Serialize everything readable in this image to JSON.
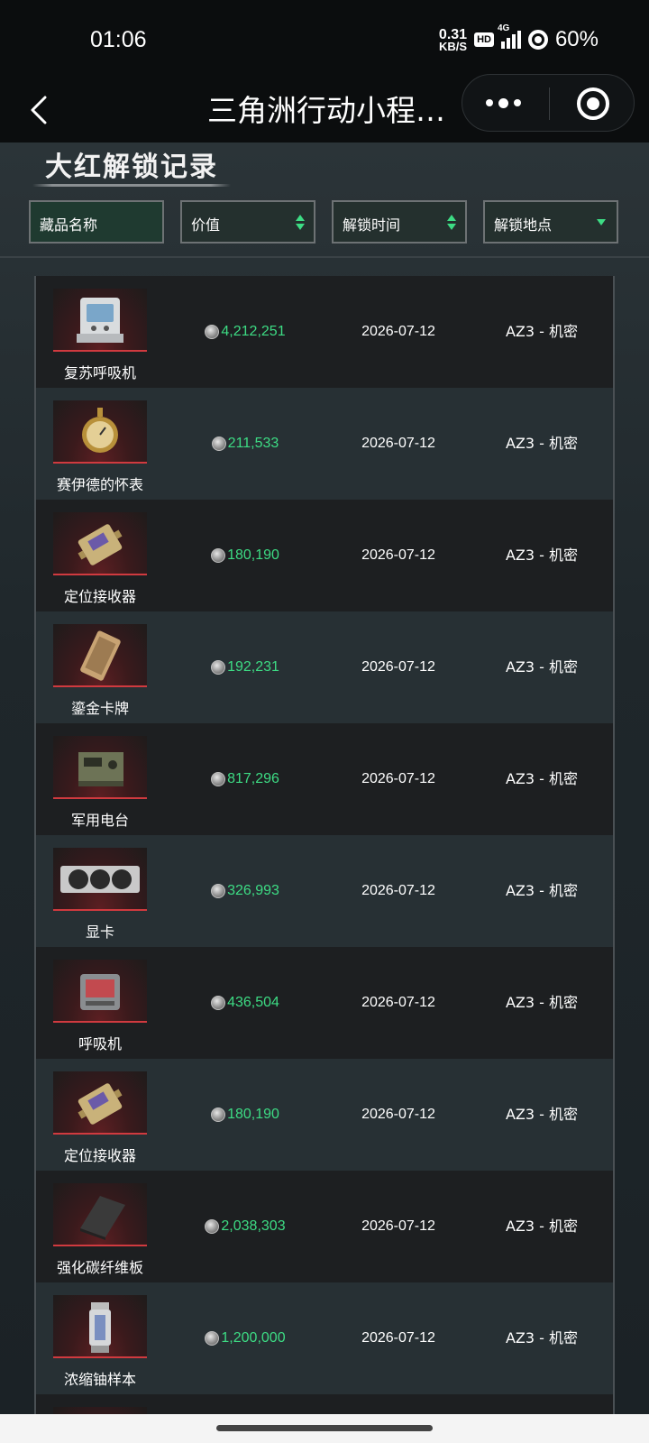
{
  "status_bar": {
    "time": "01:06",
    "net_speed_value": "0.31",
    "net_speed_unit": "KB/S",
    "hd_badge": "HD",
    "network_type": "4G",
    "battery": "60%"
  },
  "title_bar": {
    "title": "三角洲行动小程…"
  },
  "section": {
    "title": "大红解锁记录"
  },
  "filters": [
    {
      "label": "藏品名称"
    },
    {
      "label": "价值"
    },
    {
      "label": "解锁时间"
    },
    {
      "label": "解锁地点"
    }
  ],
  "items": [
    {
      "name": "复苏呼吸机",
      "value": "4,212,251",
      "date": "2026-07-12",
      "location": "AZ3 - 机密",
      "icon": "resuscitator-icon"
    },
    {
      "name": "赛伊德的怀表",
      "value": "211,533",
      "date": "2026-07-12",
      "location": "AZ3 - 机密",
      "icon": "pocket-watch-icon"
    },
    {
      "name": "定位接收器",
      "value": "180,190",
      "date": "2026-07-12",
      "location": "AZ3 - 机密",
      "icon": "gps-receiver-icon"
    },
    {
      "name": "鎏金卡牌",
      "value": "192,231",
      "date": "2026-07-12",
      "location": "AZ3 - 机密",
      "icon": "gilded-card-icon"
    },
    {
      "name": "军用电台",
      "value": "817,296",
      "date": "2026-07-12",
      "location": "AZ3 - 机密",
      "icon": "military-radio-icon"
    },
    {
      "name": "显卡",
      "value": "326,993",
      "date": "2026-07-12",
      "location": "AZ3 - 机密",
      "icon": "graphics-card-icon"
    },
    {
      "name": "呼吸机",
      "value": "436,504",
      "date": "2026-07-12",
      "location": "AZ3 - 机密",
      "icon": "ventilator-icon"
    },
    {
      "name": "定位接收器",
      "value": "180,190",
      "date": "2026-07-12",
      "location": "AZ3 - 机密",
      "icon": "gps-receiver-icon"
    },
    {
      "name": "强化碳纤维板",
      "value": "2,038,303",
      "date": "2026-07-12",
      "location": "AZ3 - 机密",
      "icon": "carbon-plate-icon"
    },
    {
      "name": "浓缩铀样本",
      "value": "1,200,000",
      "date": "2026-07-12",
      "location": "AZ3 - 机密",
      "icon": "uranium-sample-icon"
    }
  ],
  "colors": {
    "value_green": "#3ddc84",
    "thumb_red": "#d03a3f",
    "row_dark": "#1d1f21",
    "row_light": "#273034"
  }
}
